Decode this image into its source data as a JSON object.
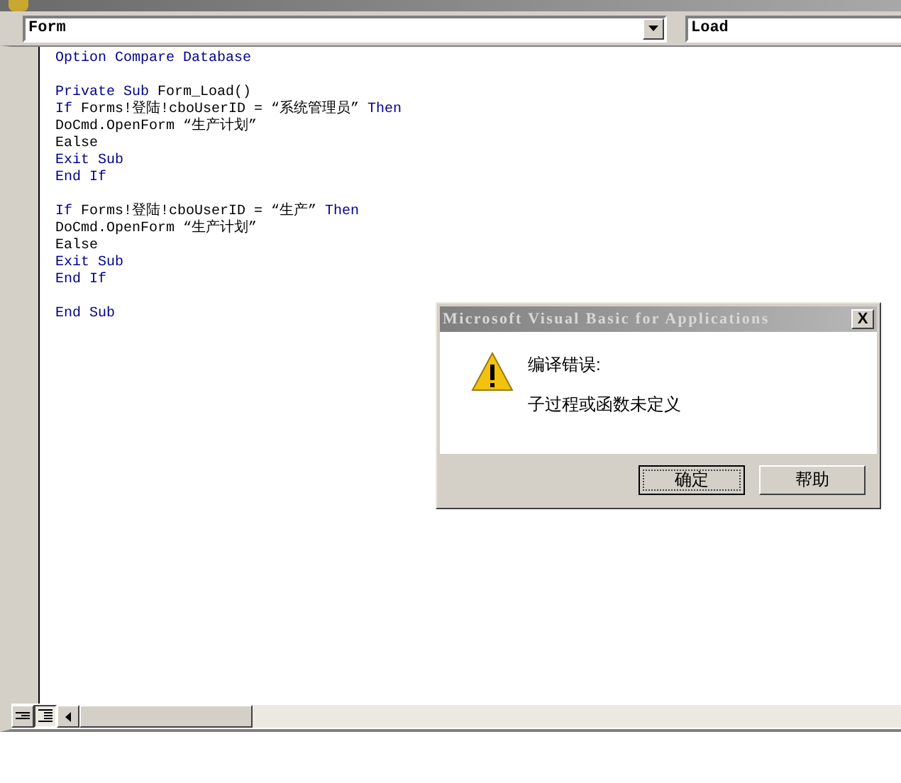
{
  "object_combo": {
    "value": "Form"
  },
  "procedure_combo": {
    "value": "Load"
  },
  "code_blocks": [
    [
      [
        {
          "text": "Option Compare Database",
          "kind": "keyword"
        }
      ]
    ],
    [
      [
        {
          "text": "Private Sub",
          "kind": "keyword"
        },
        {
          "text": " Form_Load()",
          "kind": "plain"
        }
      ],
      [
        {
          "text": "If",
          "kind": "keyword"
        },
        {
          "text": " Forms!登陆!cboUserID = “系统管理员” ",
          "kind": "plain"
        },
        {
          "text": "Then",
          "kind": "keyword"
        }
      ],
      [
        {
          "text": "DoCmd.OpenForm “生产计划”",
          "kind": "plain"
        }
      ],
      [
        {
          "text": "Ealse",
          "kind": "plain"
        }
      ],
      [
        {
          "text": "Exit Sub",
          "kind": "keyword"
        }
      ],
      [
        {
          "text": "End If",
          "kind": "keyword"
        }
      ]
    ],
    [
      [
        {
          "text": "If",
          "kind": "keyword"
        },
        {
          "text": " Forms!登陆!cboUserID = “生产” ",
          "kind": "plain"
        },
        {
          "text": "Then",
          "kind": "keyword"
        }
      ],
      [
        {
          "text": "DoCmd.OpenForm “生产计划”",
          "kind": "plain"
        }
      ],
      [
        {
          "text": "Ealse",
          "kind": "plain"
        }
      ],
      [
        {
          "text": "Exit Sub",
          "kind": "keyword"
        }
      ],
      [
        {
          "text": "End If",
          "kind": "keyword"
        }
      ]
    ],
    [
      [
        {
          "text": "End Sub",
          "kind": "keyword"
        }
      ]
    ]
  ],
  "dialog": {
    "title": "Microsoft Visual Basic for Applications",
    "close": "X",
    "heading": "编译错误:",
    "message": "子过程或函数未定义",
    "buttons": [
      {
        "label": "确定",
        "focused": true
      },
      {
        "label": "帮助",
        "focused": false
      }
    ]
  }
}
